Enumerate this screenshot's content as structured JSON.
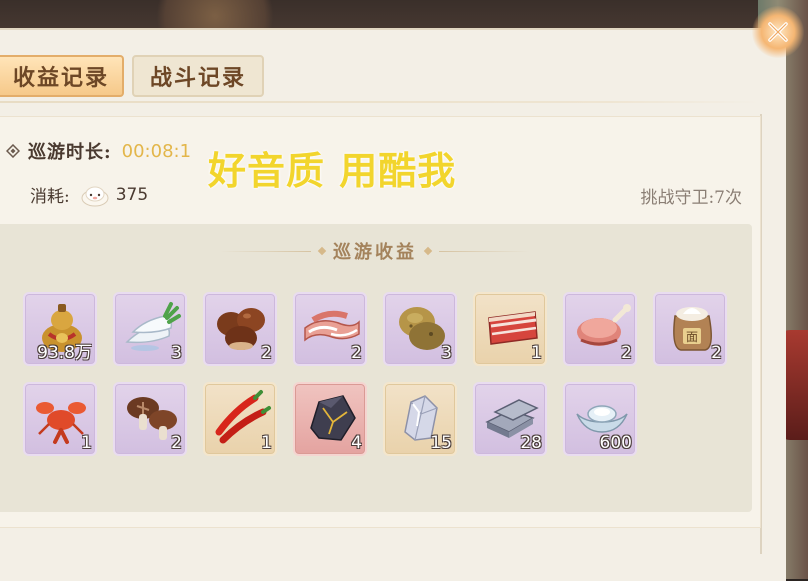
{
  "tabs": [
    {
      "label": "收益记录",
      "active": true
    },
    {
      "label": "战斗记录",
      "active": false
    }
  ],
  "summary": {
    "duration_label": "巡游时长:",
    "duration_value": "00:08:1",
    "cost_label": "消耗:",
    "cost_icon": "steamed-bun-icon",
    "cost_value": "375",
    "guard_text": "挑战守卫:7次"
  },
  "watermark": "好音质 用酷我",
  "rewards": {
    "title": "巡游收益",
    "items": [
      {
        "icon": "gourd-money-icon",
        "qty": "93.8万",
        "frame": "purple"
      },
      {
        "icon": "radish-icon",
        "qty": "3",
        "frame": "purple"
      },
      {
        "icon": "chestnut-icon",
        "qty": "2",
        "frame": "purple"
      },
      {
        "icon": "bacon-icon",
        "qty": "2",
        "frame": "purple"
      },
      {
        "icon": "potato-icon",
        "qty": "3",
        "frame": "purple"
      },
      {
        "icon": "pork-belly-icon",
        "qty": "1",
        "frame": "gold"
      },
      {
        "icon": "ham-icon",
        "qty": "2",
        "frame": "purple"
      },
      {
        "icon": "flour-sack-icon",
        "qty": "2",
        "frame": "purple"
      },
      {
        "icon": "crayfish-icon",
        "qty": "1",
        "frame": "purple"
      },
      {
        "icon": "shiitake-icon",
        "qty": "2",
        "frame": "purple"
      },
      {
        "icon": "chili-icon",
        "qty": "1",
        "frame": "gold"
      },
      {
        "icon": "dark-ore-icon",
        "qty": "4",
        "frame": "red"
      },
      {
        "icon": "crystal-icon",
        "qty": "15",
        "frame": "gold"
      },
      {
        "icon": "iron-ingot-icon",
        "qty": "28",
        "frame": "purple"
      },
      {
        "icon": "silver-ingot-icon",
        "qty": "600",
        "frame": "purple"
      }
    ]
  },
  "colors": {
    "panel_bg": "#f3efe6",
    "tab_active": "#f6c98a",
    "duration_value": "#e3b64a",
    "watermark": "#f2d52d",
    "rewards_bg": "#e8e4d6"
  }
}
